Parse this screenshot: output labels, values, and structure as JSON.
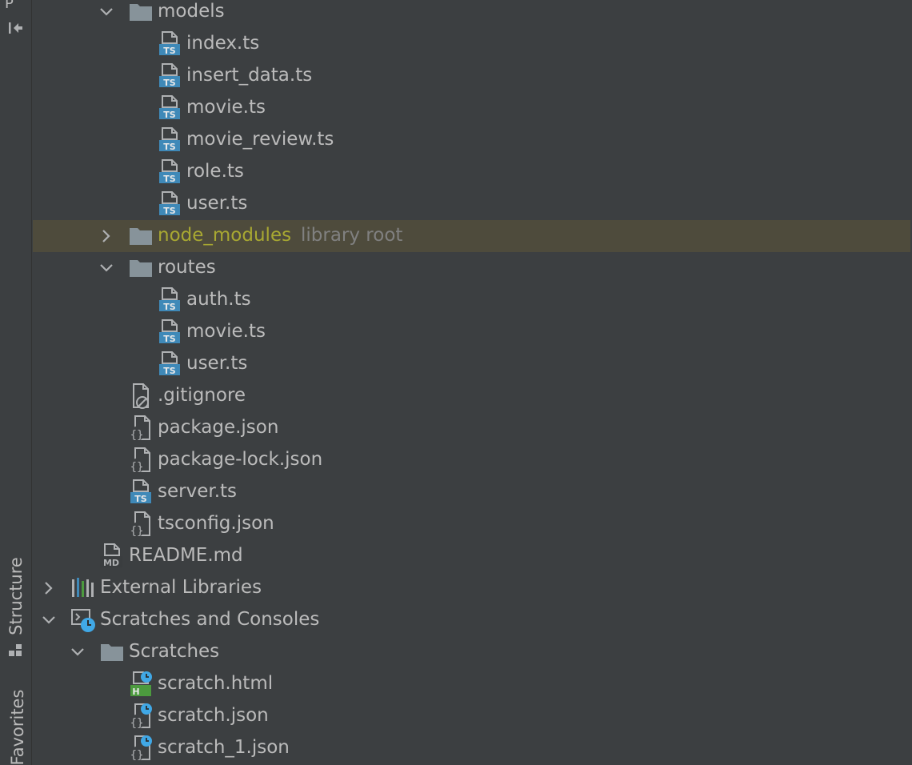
{
  "side_tabs": {
    "project": "P",
    "structure": "Structure",
    "favorites": "Favorites"
  },
  "colors": {
    "background": "#3c3f41",
    "text": "#bbbbbb",
    "library_root_text": "#a8a832",
    "hint_text": "#808080",
    "highlight_row": "#4e4b3c",
    "ts_badge": "#3f89b8",
    "html_badge": "#4c9a3e",
    "scratch_clock": "#40a8e6"
  },
  "tree": {
    "rows": [
      {
        "label": "models",
        "icon": "folder-icon",
        "expanded": true
      },
      {
        "label": "index.ts",
        "icon": "typescript-file-icon"
      },
      {
        "label": "insert_data.ts",
        "icon": "typescript-file-icon"
      },
      {
        "label": "movie.ts",
        "icon": "typescript-file-icon"
      },
      {
        "label": "movie_review.ts",
        "icon": "typescript-file-icon"
      },
      {
        "label": "role.ts",
        "icon": "typescript-file-icon"
      },
      {
        "label": "user.ts",
        "icon": "typescript-file-icon"
      },
      {
        "label": "node_modules",
        "hint": "library root",
        "icon": "folder-icon",
        "expanded": false
      },
      {
        "label": "routes",
        "icon": "folder-icon",
        "expanded": true
      },
      {
        "label": "auth.ts",
        "icon": "typescript-file-icon"
      },
      {
        "label": "movie.ts",
        "icon": "typescript-file-icon"
      },
      {
        "label": "user.ts",
        "icon": "typescript-file-icon"
      },
      {
        "label": ".gitignore",
        "icon": "ignore-file-icon"
      },
      {
        "label": "package.json",
        "icon": "json-file-icon"
      },
      {
        "label": "package-lock.json",
        "icon": "json-file-icon"
      },
      {
        "label": "server.ts",
        "icon": "typescript-file-icon"
      },
      {
        "label": "tsconfig.json",
        "icon": "json-file-icon"
      },
      {
        "label": "README.md",
        "icon": "markdown-file-icon"
      },
      {
        "label": "External Libraries",
        "icon": "libraries-icon",
        "expanded": false
      },
      {
        "label": "Scratches and Consoles",
        "icon": "scratches-icon",
        "expanded": true
      },
      {
        "label": "Scratches",
        "icon": "folder-icon",
        "expanded": true
      },
      {
        "label": "scratch.html",
        "icon": "html-scratch-icon"
      },
      {
        "label": "scratch.json",
        "icon": "json-scratch-icon"
      },
      {
        "label": "scratch_1.json",
        "icon": "json-scratch-icon"
      }
    ]
  }
}
